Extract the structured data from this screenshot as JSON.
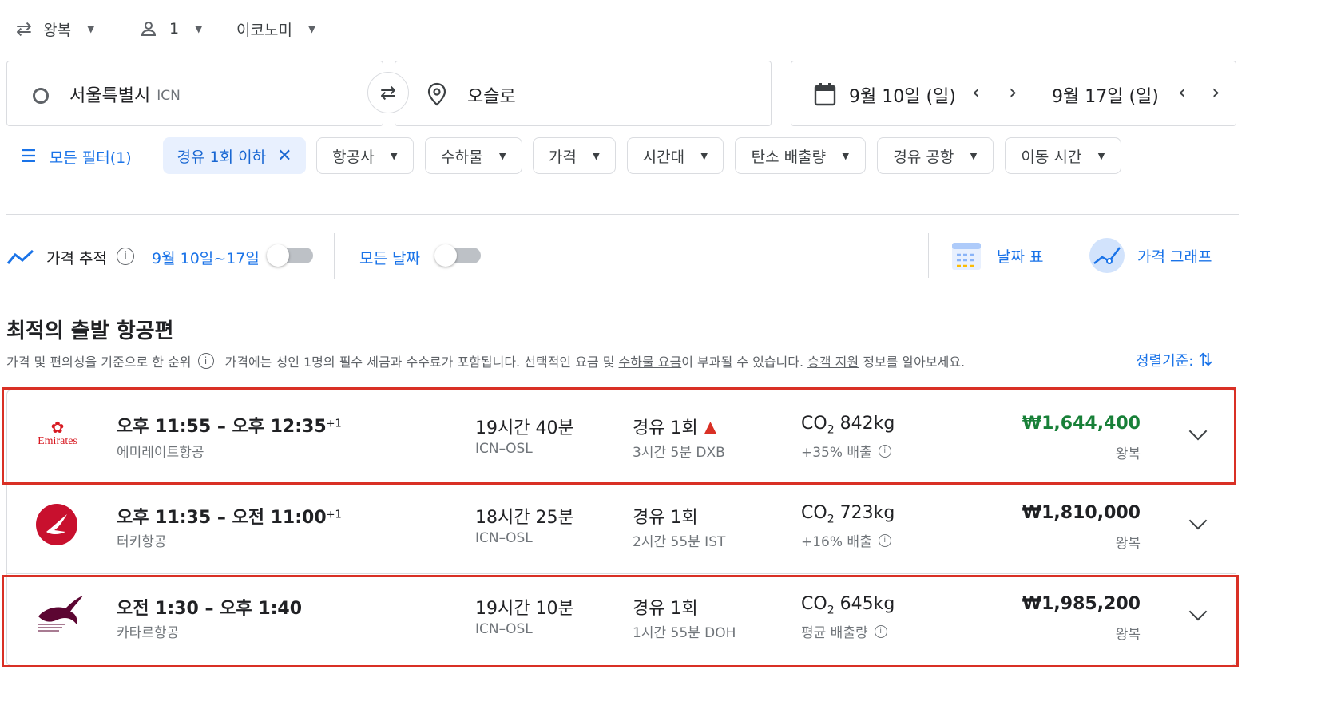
{
  "top_bar": {
    "trip_type": "왕복",
    "passengers": "1",
    "cabin": "이코노미"
  },
  "search": {
    "origin_city": "서울특별시",
    "origin_code": "ICN",
    "destination": "오슬로",
    "depart_date": "9월 10일 (일)",
    "return_date": "9월 17일 (일)"
  },
  "filters": {
    "all_filters": "모든 필터(1)",
    "active_chip": "경유 1회 이하",
    "chips": [
      "항공사",
      "수하물",
      "가격",
      "시간대",
      "탄소 배출량",
      "경유 공항",
      "이동 시간"
    ]
  },
  "tracking": {
    "label": "가격 추적",
    "date_range": "9월 10일~17일",
    "all_dates": "모든 날짜",
    "date_grid": "날짜 표",
    "price_graph": "가격 그래프"
  },
  "results": {
    "heading": "최적의 출발 항공편",
    "sort_note": "가격 및 편의성을 기준으로 한 순위",
    "info_prefix": "가격에는 성인 1명의 필수 세금과 수수료가 포함됩니다. 선택적인 요금 및 ",
    "info_link1": "수하물 요금",
    "info_mid": "이 부과될 수 있습니다. ",
    "info_link2": "승객 지원",
    "info_suffix": " 정보를 알아보세요.",
    "sort_label": "정렬기준:"
  },
  "flights": [
    {
      "airline": "에미레이트항공",
      "logo_text": "Emirates",
      "times": "오후 11:55 – 오후 12:35",
      "day_offset": "+1",
      "duration": "19시간 40분",
      "route": "ICN–OSL",
      "stops": "경유 1회",
      "layover": "3시간 5분 DXB",
      "co2_value": "842kg",
      "emissions": "+35% 배출",
      "price": "₩1,644,400",
      "price_type": "왕복",
      "price_color": "#188038"
    },
    {
      "airline": "터키항공",
      "times": "오후 11:35 – 오전 11:00",
      "day_offset": "+1",
      "duration": "18시간 25분",
      "route": "ICN–OSL",
      "stops": "경유 1회",
      "layover": "2시간 55분 IST",
      "co2_value": "723kg",
      "emissions": "+16% 배출",
      "price": "₩1,810,000",
      "price_type": "왕복",
      "price_color": "#202124"
    },
    {
      "airline": "카타르항공",
      "times": "오전 1:30 – 오후 1:40",
      "day_offset": "",
      "duration": "19시간 10분",
      "route": "ICN–OSL",
      "stops": "경유 1회",
      "layover": "1시간 55분 DOH",
      "co2_value": "645kg",
      "emissions": "평균 배출량",
      "price": "₩1,985,200",
      "price_type": "왕복",
      "price_color": "#202124"
    }
  ],
  "co2_label": "CO",
  "co2_sub": "2"
}
